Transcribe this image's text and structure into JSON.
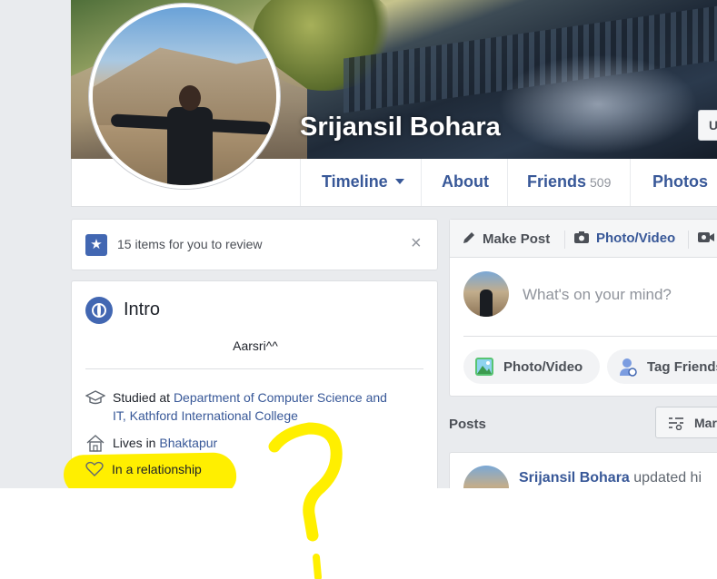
{
  "profile": {
    "name": "Srijansil Bohara",
    "cover_button_label": "U"
  },
  "nav": {
    "tabs": [
      {
        "label": "Timeline",
        "has_caret": true
      },
      {
        "label": "About"
      },
      {
        "label": "Friends",
        "count": "509"
      },
      {
        "label": "Photos"
      }
    ]
  },
  "review": {
    "text": "15 items for you to review",
    "close_label": "×"
  },
  "intro": {
    "title": "Intro",
    "bio": "Aarsri^^",
    "studied_prefix": "Studied at ",
    "studied_link": "Department of Computer Science and IT, Kathford International College",
    "lives_prefix": "Lives in ",
    "lives_link": "Bhaktapur",
    "relationship": "In a relationship"
  },
  "composer": {
    "tabs": [
      {
        "label": "Make Post",
        "icon": "pencil-icon"
      },
      {
        "label": "Photo/Video",
        "icon": "camera-icon"
      }
    ],
    "placeholder": "What's on your mind?",
    "actions": [
      {
        "label": "Photo/Video",
        "icon": "photo-icon"
      },
      {
        "label": "Tag Friends",
        "icon": "tag-friends-icon"
      }
    ]
  },
  "posts": {
    "label": "Posts",
    "manage_label": "Mar",
    "first_post": {
      "author": "Srijansil Bohara",
      "action": " updated hi"
    }
  },
  "annotations": {
    "highlight_color": "#ffef00",
    "question_mark": "?"
  },
  "colors": {
    "link": "#385898",
    "accent": "#4267b2",
    "background": "#e9ebee"
  }
}
